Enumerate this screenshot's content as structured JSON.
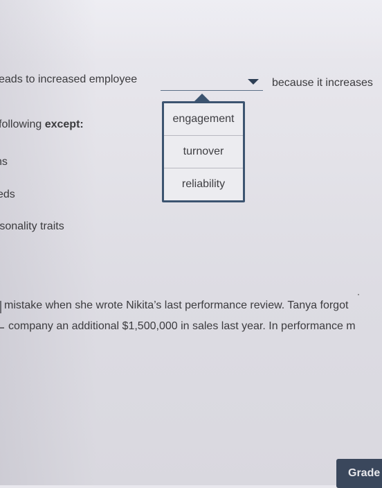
{
  "question1": {
    "prefix": "eads to increased employee",
    "suffix": "because it increases",
    "dropdown": {
      "selected": "",
      "options": [
        "engagement",
        "turnover",
        "reliability"
      ]
    }
  },
  "question2": {
    "prompt_start": "following ",
    "prompt_bold": "except",
    "prompt_end": ":",
    "answers": [
      "ns",
      "eds",
      "rsonality traits"
    ]
  },
  "passage": {
    "line1": "mistake when she wrote Nikita’s last performance review. Tanya forgot",
    "line2": "company an additional $1,500,000 in sales last year. In performance m"
  },
  "footer": {
    "grade_label": "Grade"
  }
}
